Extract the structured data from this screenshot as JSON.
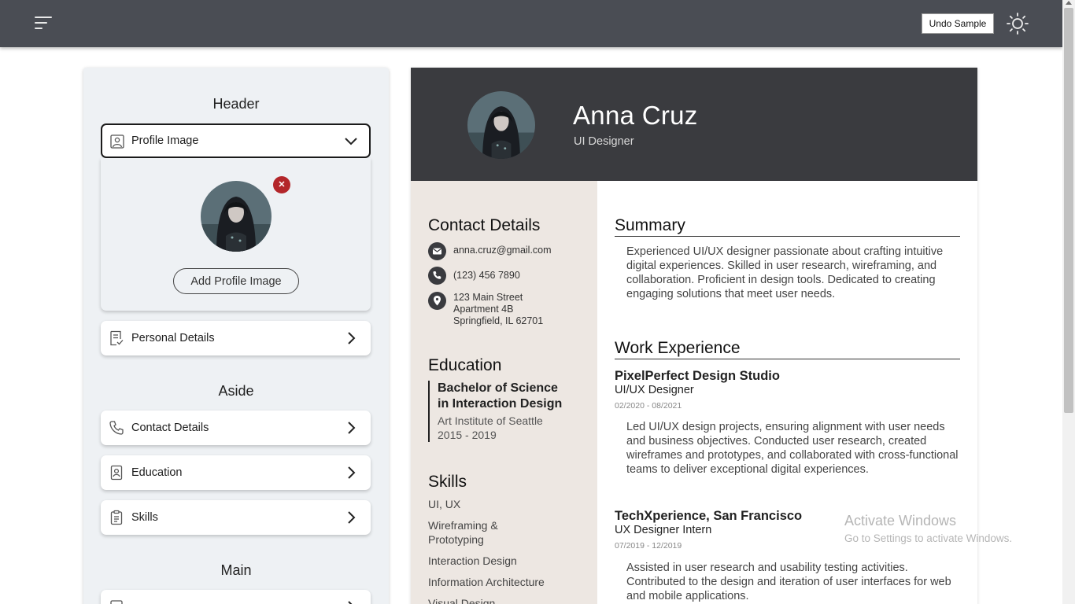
{
  "topbar": {
    "undo_label": "Undo Sample"
  },
  "editor": {
    "header_title": "Header",
    "profile_card_label": "Profile Image",
    "add_image_label": "Add Profile Image",
    "remove_label": "✕",
    "personal_label": "Personal Details",
    "aside_title": "Aside",
    "aside_items": [
      {
        "label": "Contact Details"
      },
      {
        "label": "Education"
      },
      {
        "label": "Skills"
      }
    ],
    "main_title": "Main"
  },
  "resume": {
    "name": "Anna Cruz",
    "title": "UI Designer",
    "contact_title": "Contact Details",
    "email": "anna.cruz@gmail.com",
    "phone": "(123) 456 7890",
    "address_line1": "123 Main Street",
    "address_line2": "Apartment 4B",
    "address_line3": "Springfield, IL 62701",
    "education_title": "Education",
    "degree_line1": "Bachelor of Science",
    "degree_line2": "in Interaction Design",
    "school": "Art Institute of Seattle",
    "years": "2015 - 2019",
    "skills_title": "Skills",
    "skills": [
      "UI, UX",
      "Wireframing & Prototyping",
      "Interaction Design",
      "Information Architecture",
      "Visual Design"
    ],
    "summary_title": "Summary",
    "summary": "Experienced UI/UX designer passionate about crafting intuitive digital experiences. Skilled in user research, wireframing, and collaboration. Proficient in design tools. Dedicated to creating engaging solutions that meet user needs.",
    "work_title": "Work Experience",
    "jobs": [
      {
        "company": "PixelPerfect Design Studio",
        "role": "UI/UX Designer",
        "dates": "02/2020 - 08/2021",
        "description": "Led UI/UX design projects, ensuring alignment with user needs and business objectives. Conducted user research, created wireframes and prototypes, and collaborated with cross-functional teams to deliver exceptional digital experiences."
      },
      {
        "company": "TechXperience, San Francisco",
        "role": "UX Designer Intern",
        "dates": "07/2019 - 12/2019",
        "description": "Assisted in user research and usability testing activities. Contributed to the design and iteration of user interfaces for web and mobile applications."
      }
    ]
  },
  "watermark": {
    "line1": "Activate Windows",
    "line2": "Go to Settings to activate Windows."
  },
  "icons": {
    "menu": "menu-icon",
    "theme": "sun-icon",
    "profile": "image-icon",
    "personal": "document-check-icon",
    "contact": "phone-icon",
    "education": "id-badge-icon",
    "skills": "clipboard-icon"
  },
  "colors": {
    "topbar": "#4a4d54",
    "resume_header": "#3a3b3f",
    "aside_bg": "#ede7e2",
    "remove": "#b3262a"
  }
}
